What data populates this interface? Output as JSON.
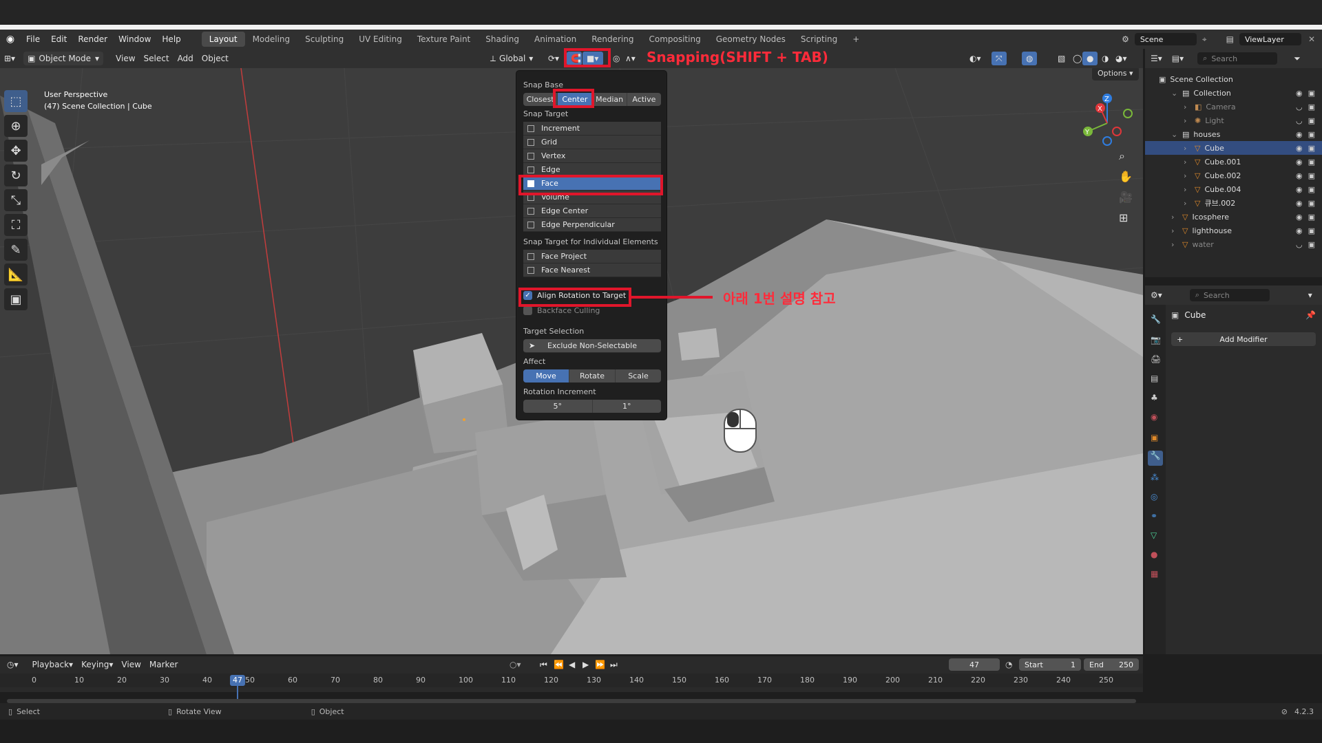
{
  "menus": [
    "File",
    "Edit",
    "Render",
    "Window",
    "Help"
  ],
  "workspaces": [
    "Layout",
    "Modeling",
    "Sculpting",
    "UV Editing",
    "Texture Paint",
    "Shading",
    "Animation",
    "Rendering",
    "Compositing",
    "Geometry Nodes",
    "Scripting"
  ],
  "active_workspace": "Layout",
  "scene_name": "Scene",
  "viewlayer_name": "ViewLayer",
  "header": {
    "mode": "Object Mode",
    "menus": [
      "View",
      "Select",
      "Add",
      "Object"
    ],
    "orientation": "Global",
    "options": "Options",
    "search_placeholder": "Search"
  },
  "viewport": {
    "perspective": "User Perspective",
    "collection_info": "(47) Scene Collection | Cube",
    "gizmo": {
      "x": "X",
      "y": "Y",
      "z": "Z"
    }
  },
  "annotations": {
    "snapping": "Snapping(SHIFT + TAB)",
    "note": "아래 1번 설명 참고"
  },
  "snapping_popup": {
    "snap_base_label": "Snap Base",
    "snap_base": [
      "Closest",
      "Center",
      "Median",
      "Active"
    ],
    "snap_base_selected": "Center",
    "snap_target_label": "Snap Target",
    "snap_target": [
      "Increment",
      "Grid",
      "Vertex",
      "Edge",
      "Face",
      "Volume",
      "Edge Center",
      "Edge Perpendicular"
    ],
    "snap_target_selected": "Face",
    "individual_label": "Snap Target for Individual Elements",
    "individual": [
      "Face Project",
      "Face Nearest"
    ],
    "align_rotation": "Align Rotation to Target",
    "backface": "Backface Culling",
    "target_selection_label": "Target Selection",
    "exclude": "Exclude Non-Selectable",
    "affect_label": "Affect",
    "affect": [
      "Move",
      "Rotate",
      "Scale"
    ],
    "affect_selected": "Move",
    "rotation_increment_label": "Rotation Increment",
    "rotation_increment": [
      "5°",
      "1°"
    ]
  },
  "outliner": {
    "root": "Scene Collection",
    "rows": [
      {
        "name": "Collection",
        "depth": 1,
        "kind": "collection"
      },
      {
        "name": "Camera",
        "depth": 2,
        "kind": "camera",
        "dim": true
      },
      {
        "name": "Light",
        "depth": 2,
        "kind": "light",
        "dim": true
      },
      {
        "name": "houses",
        "depth": 1,
        "kind": "collection"
      },
      {
        "name": "Cube",
        "depth": 2,
        "kind": "mesh",
        "selected": true
      },
      {
        "name": "Cube.001",
        "depth": 2,
        "kind": "mesh"
      },
      {
        "name": "Cube.002",
        "depth": 2,
        "kind": "mesh"
      },
      {
        "name": "Cube.004",
        "depth": 2,
        "kind": "mesh"
      },
      {
        "name": "큐브.002",
        "depth": 2,
        "kind": "mesh"
      },
      {
        "name": "Icosphere",
        "depth": 1,
        "kind": "mesh"
      },
      {
        "name": "lighthouse",
        "depth": 1,
        "kind": "mesh"
      },
      {
        "name": "water",
        "depth": 1,
        "kind": "mesh",
        "dim": true
      }
    ]
  },
  "properties": {
    "search_placeholder": "Search",
    "object_name": "Cube",
    "add_modifier": "Add Modifier"
  },
  "timeline": {
    "menus": [
      "Playback",
      "Keying",
      "View",
      "Marker"
    ],
    "current_frame": "47",
    "start_label": "Start",
    "start": "1",
    "end_label": "End",
    "end": "250",
    "ticks": [
      "0",
      "10",
      "20",
      "30",
      "40",
      "50",
      "60",
      "70",
      "80",
      "90",
      "100",
      "110",
      "120",
      "130",
      "140",
      "150",
      "160",
      "170",
      "180",
      "190",
      "200",
      "210",
      "220",
      "230",
      "240",
      "250"
    ]
  },
  "status": {
    "select": "Select",
    "rotate": "Rotate View",
    "object": "Object",
    "version": "4.2.3"
  },
  "colors": {
    "accent": "#4772b3",
    "annotation_red": "#e0162b"
  }
}
